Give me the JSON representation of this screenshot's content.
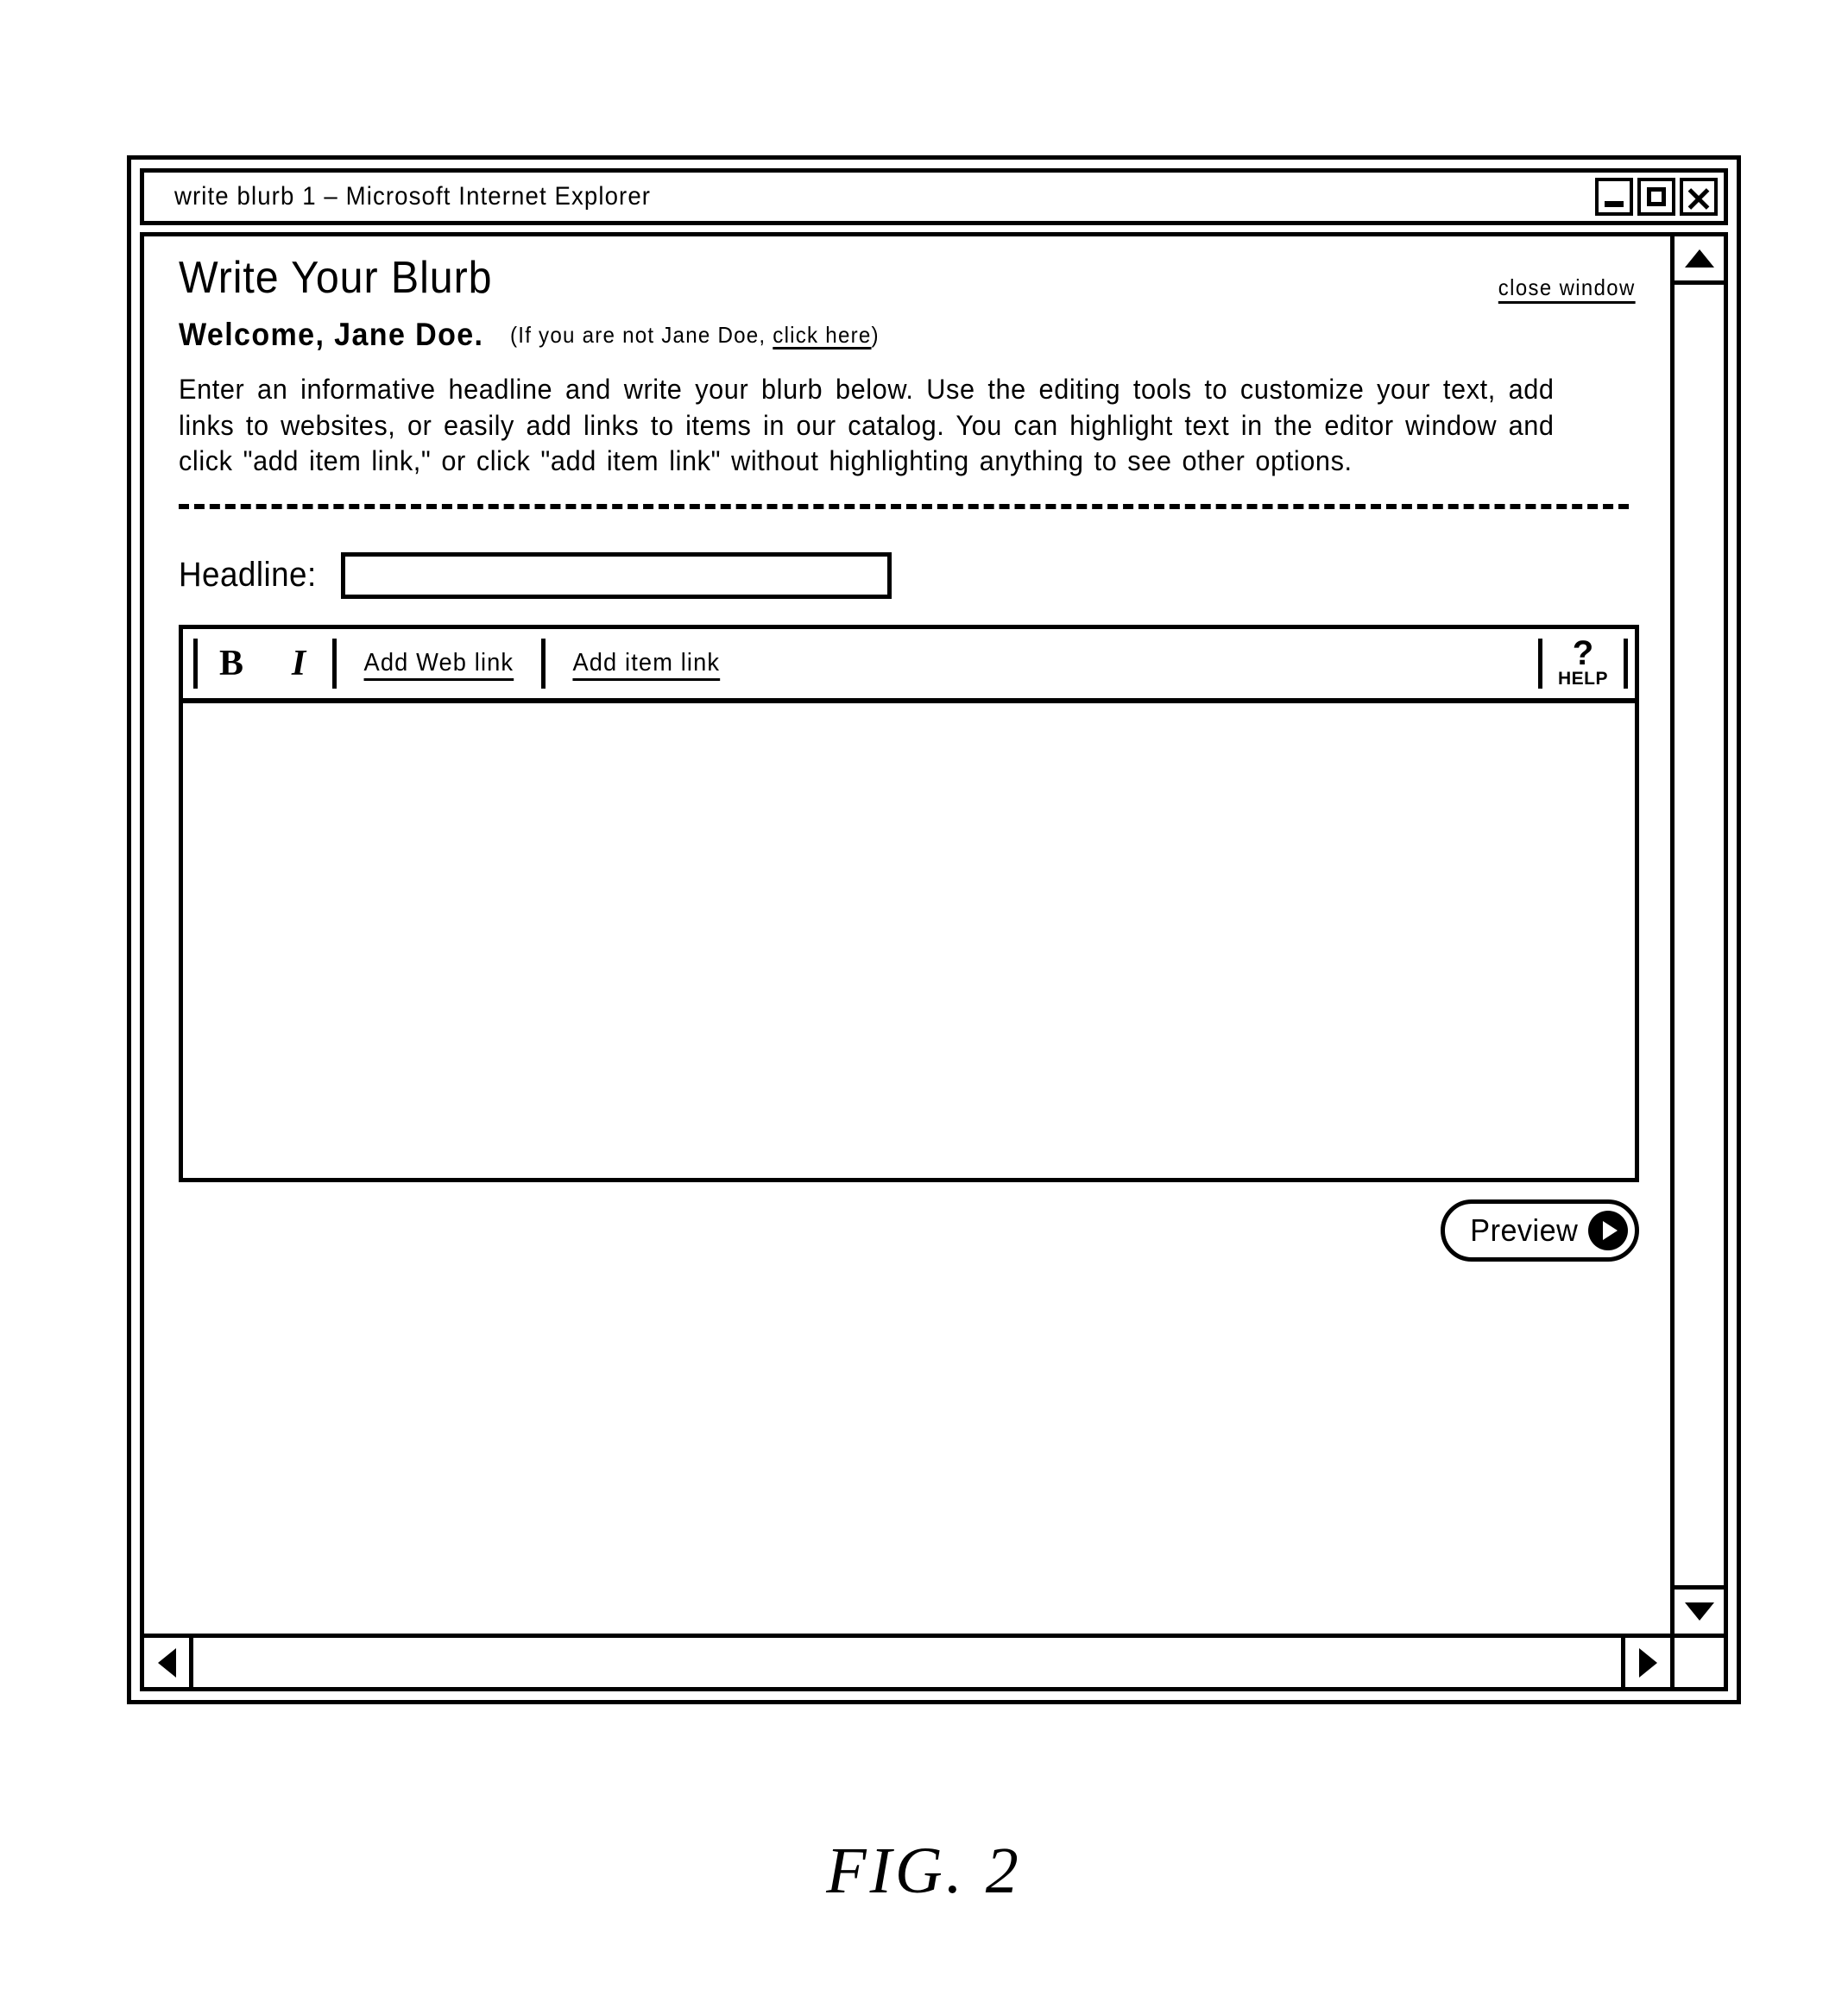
{
  "window": {
    "title": "write blurb 1 – Microsoft Internet Explorer",
    "controls": {
      "minimize": "minimize",
      "maximize": "maximize",
      "close": "close"
    }
  },
  "page": {
    "title": "Write Your Blurb",
    "close_window_link": "close window",
    "welcome": {
      "greeting": "Welcome, Jane Doe.",
      "paren_open": "(If you are not Jane Doe, ",
      "link": "click here",
      "paren_close": ")"
    },
    "instructions": "Enter an informative headline and write your blurb below. Use the editing tools to customize your text, add links to websites, or easily add links to items in our catalog. You can highlight text in the editor window and click \"add item link,\" or click \"add item link\" without highlighting anything to see other options."
  },
  "form": {
    "headline_label": "Headline:",
    "headline_value": "",
    "headline_placeholder": ""
  },
  "toolbar": {
    "bold": "B",
    "italic": "I",
    "add_web_link": "Add Web link",
    "add_item_link": "Add item link",
    "help_mark": "?",
    "help_label": "HELP"
  },
  "editor": {
    "body_text": ""
  },
  "actions": {
    "preview": "Preview"
  },
  "scrollbars": {
    "up_arrow": "▲",
    "down_arrow": "▼",
    "left_arrow": "◀",
    "right_arrow": "▶"
  },
  "figure": {
    "caption": "FIG.  2"
  }
}
